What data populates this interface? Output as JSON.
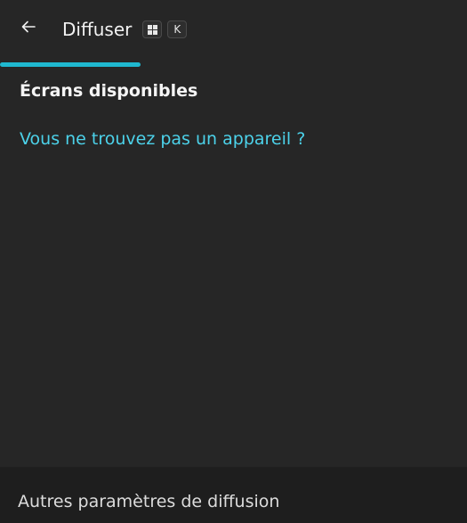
{
  "header": {
    "title": "Diffuser",
    "back_icon": "arrow-left-icon",
    "shortcut": {
      "windows_key_icon": "windows-logo-icon",
      "key": "K"
    }
  },
  "progress": {
    "value": 0.3,
    "color": "#1fb8cf",
    "indeterminate": true
  },
  "content": {
    "section_heading": "Écrans disponibles",
    "help_link": "Vous ne trouvez pas un appareil ?",
    "link_color": "#4cd2ea"
  },
  "footer": {
    "label": "Autres paramètres de diffusion"
  }
}
